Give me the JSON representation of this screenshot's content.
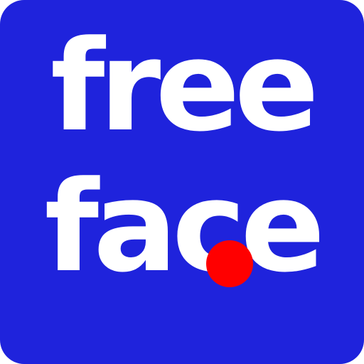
{
  "logo": {
    "line1": "free",
    "line2": "face",
    "colors": {
      "background": "#1f23dc",
      "text": "#ffffff",
      "dot": "#ff0000"
    }
  }
}
